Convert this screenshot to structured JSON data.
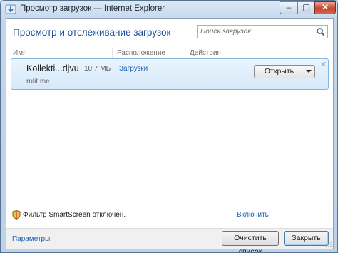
{
  "window": {
    "title": "Просмотр загрузок — Internet Explorer",
    "controls": {
      "minimize": "‒",
      "maximize": "▢",
      "close": "✕"
    }
  },
  "header": {
    "title": "Просмотр и отслеживание загрузок",
    "search_placeholder": "Поиск загрузок"
  },
  "columns": [
    "Имя",
    "Расположение",
    "Действия"
  ],
  "downloads": [
    {
      "name": "Kollekti...djvu",
      "size": "10,7 МБ",
      "site": "rulit.me",
      "location": "Загрузки",
      "action_label": "Открыть"
    }
  ],
  "status": {
    "text": "Фильтр SmartScreen отключен.",
    "enable_link": "Включить"
  },
  "footer": {
    "options_link": "Параметры",
    "clear_button": "Очистить список",
    "close_button": "Закрыть"
  },
  "icons": {
    "app": "ie-download-icon",
    "search": "magnifier-icon",
    "shield": "smartscreen-shield-icon",
    "dropdown": "chevron-down-icon",
    "dismiss": "dismiss-x-icon"
  },
  "colors": {
    "accent_text": "#1c4f96",
    "link": "#1f5fb0",
    "selection": "#d6e9fa"
  }
}
